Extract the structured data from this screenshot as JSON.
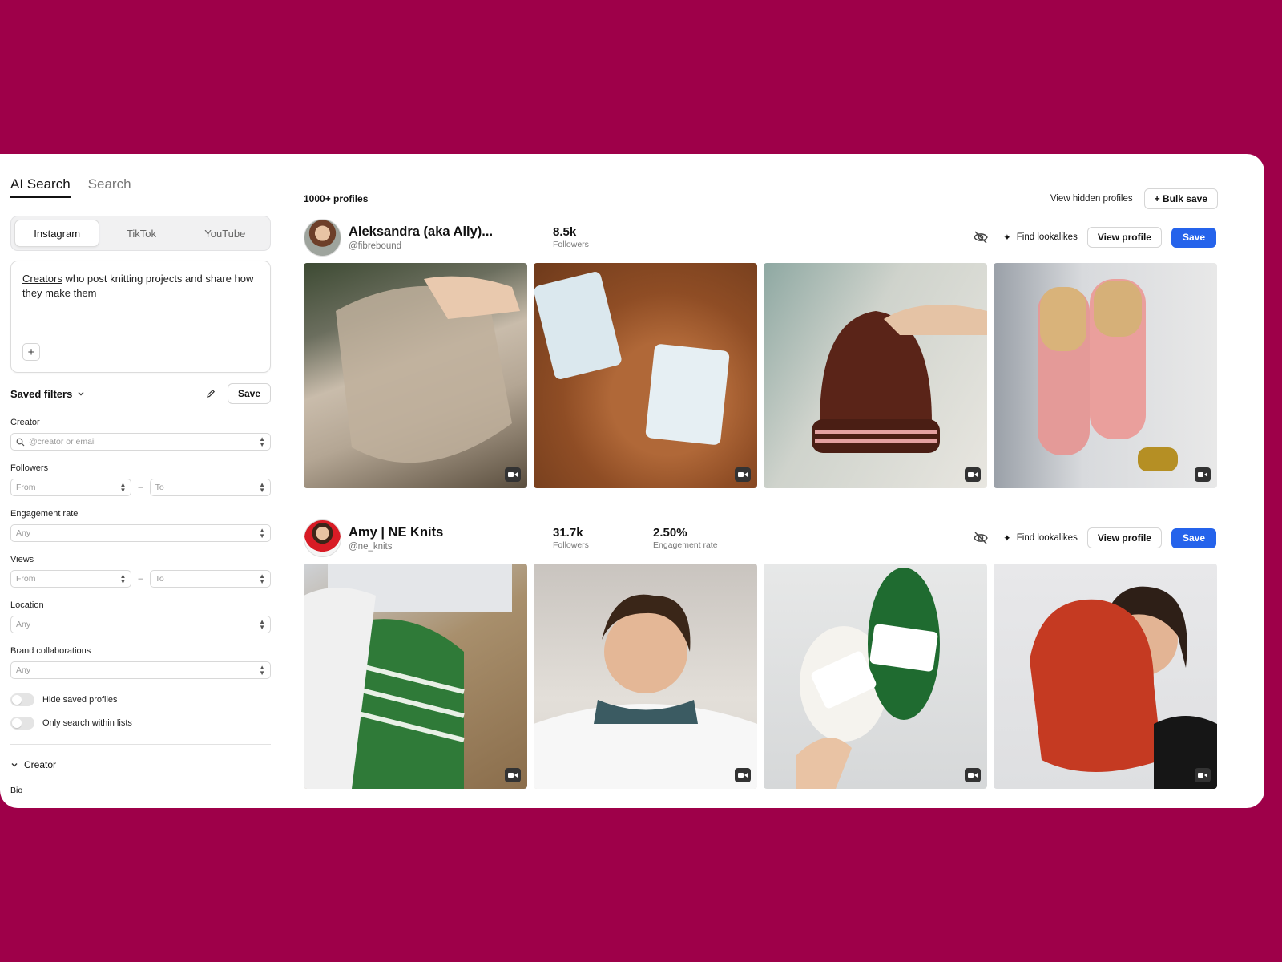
{
  "sidebar": {
    "mode_tabs": [
      "AI Search",
      "Search"
    ],
    "platforms": [
      "Instagram",
      "TikTok",
      "YouTube"
    ],
    "prompt": {
      "underlined": "Creators",
      "rest": " who post knitting projects and share how they make them"
    },
    "saved_filters_label": "Saved filters",
    "save_label": "Save",
    "creator": {
      "label": "Creator",
      "placeholder": "@creator or email"
    },
    "followers": {
      "label": "Followers",
      "from": "From",
      "to": "To"
    },
    "engagement": {
      "label": "Engagement rate",
      "value": "Any"
    },
    "views": {
      "label": "Views",
      "from": "From",
      "to": "To"
    },
    "location": {
      "label": "Location",
      "value": "Any"
    },
    "brand": {
      "label": "Brand collaborations",
      "value": "Any"
    },
    "toggles": [
      "Hide saved profiles",
      "Only search within lists"
    ],
    "section": "Creator",
    "bio_label": "Bio"
  },
  "main": {
    "count": "1000+ profiles",
    "hidden_link": "View hidden profiles",
    "bulk_save": "+ Bulk save",
    "find_lookalikes": "Find lookalikes",
    "view_profile": "View profile",
    "save": "Save",
    "profiles": [
      {
        "name": "Aleksandra (aka Ally)...",
        "handle": "@fibrebound",
        "followers": "8.5k",
        "followers_label": "Followers",
        "engagement": "",
        "engagement_label": ""
      },
      {
        "name": "Amy | NE Knits",
        "handle": "@ne_knits",
        "followers": "31.7k",
        "followers_label": "Followers",
        "engagement": "2.50%",
        "engagement_label": "Engagement rate"
      }
    ]
  },
  "colors": {
    "background": "#9e0049",
    "primary": "#2563eb"
  }
}
